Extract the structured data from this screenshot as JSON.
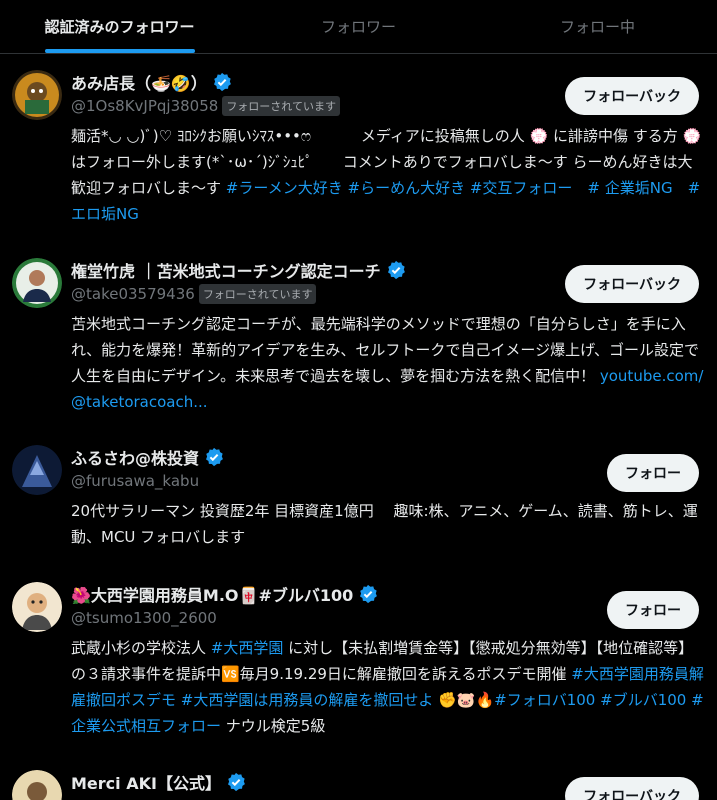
{
  "tabs": [
    {
      "label": "認証済みのフォロワー",
      "active": true
    },
    {
      "label": "フォロワー",
      "active": false
    },
    {
      "label": "フォロー中",
      "active": false
    }
  ],
  "accent_color": "#1d9bf0",
  "users": [
    {
      "name": "あみ店長（🍜🤣）",
      "handle": "@1Os8KvJPqj38058",
      "follows_you": "フォローされています",
      "button": "フォローバック",
      "bio_parts": [
        {
          "t": "麺活*◡ ◡)ﾞ)♡ ﾖﾛｼｸお願いｼﾏｽ•••ෆ　　　 メディアに投稿無しの人 💮 に誹謗中傷 する方 💮 はフォロー外します(*`･ω･´)ｼﾞｼｭﾋﾟ　　コメントありでフォロバしま〜す らーめん好きは大歓迎フォロバしま〜す "
        },
        {
          "t": "#ラーメン大好き #らーめん大好き #交互フォロー　# 企業垢NG　#エロ垢NG",
          "tag": true
        }
      ]
    },
    {
      "name": "権堂竹虎 ｜苫米地式コーチング認定コーチ",
      "handle": "@take03579436",
      "follows_you": "フォローされています",
      "button": "フォローバック",
      "bio_parts": [
        {
          "t": "苫米地式コーチング認定コーチが、最先端科学のメソッドで理想の「自分らしさ」を手に入れ、能力を爆発！革新的アイデアを生み、セルフトークで自己イメージ爆上げ、ゴール設定で人生を自由にデザイン。未来思考で過去を壊し、夢を掴む方法を熱く配信中！ "
        },
        {
          "t": "youtube.com/@taketoracoach...",
          "link": true
        }
      ]
    },
    {
      "name": "ふるさわ@株投資",
      "handle": "@furusawa_kabu",
      "follows_you": "",
      "button": "フォロー",
      "bio_parts": [
        {
          "t": "20代サラリーマン 投資歴2年 目標資産1億円　 趣味:株、アニメ、ゲーム、読書、筋トレ、運動、MCU フォロバします"
        }
      ]
    },
    {
      "name": "🌺大西学園用務員M.O🀄#ブルバ100",
      "handle": "@tsumo1300_2600",
      "follows_you": "",
      "button": "フォロー",
      "bio_parts": [
        {
          "t": "武蔵小杉の学校法人 "
        },
        {
          "t": "#大西学園",
          "tag": true
        },
        {
          "t": " に対し【未払割増賃金等】【懲戒処分無効等】【地位確認等】の３請求事件を提訴中🆚毎月9.19.29日に解雇撤回を訴えるポスデモ開催 "
        },
        {
          "t": "#大西学園用務員解雇撤回ポスデモ #大西学園は用務員の解雇を撤回せよ",
          "tag": true
        },
        {
          "t": " ✊🐷🔥"
        },
        {
          "t": "#フォロバ100 #ブルバ100 #企業公式相互フォロー",
          "tag": true
        },
        {
          "t": " ナウル検定5級"
        }
      ]
    },
    {
      "name": "Merci AKI【公式】",
      "handle": "",
      "follows_you": "",
      "button": "フォローバック",
      "bio_parts": []
    }
  ]
}
